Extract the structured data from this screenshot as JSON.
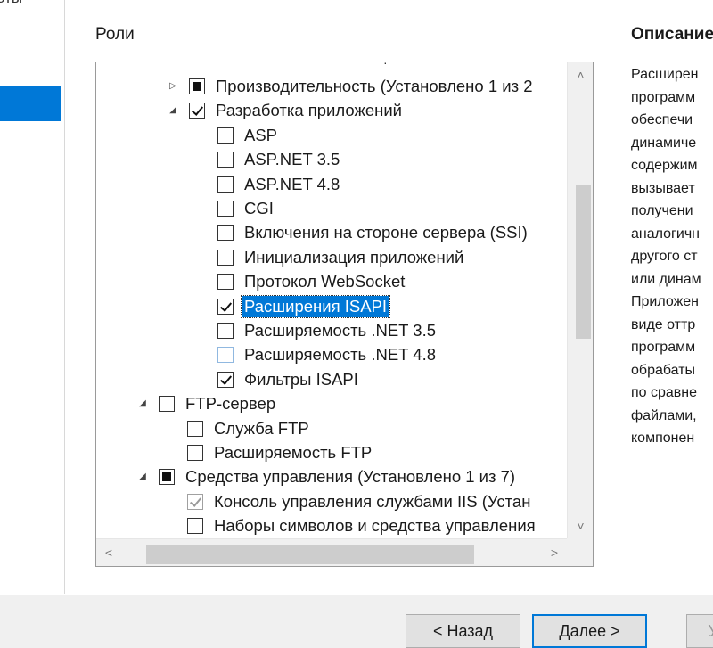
{
  "left_panel": {
    "cut_text": "оты"
  },
  "headings": {
    "roles": "Роли",
    "description": "Описание"
  },
  "tree": {
    "cut_top_text": "·",
    "rows": [
      {
        "label": "Производительность (Установлено 1 из 2",
        "state": "partial",
        "expander": "collapsed"
      },
      {
        "label": "Разработка приложений",
        "state": "checked",
        "expander": "expanded"
      },
      {
        "label": "ASP",
        "state": "unchecked"
      },
      {
        "label": "ASP.NET 3.5",
        "state": "unchecked"
      },
      {
        "label": "ASP.NET 4.8",
        "state": "unchecked"
      },
      {
        "label": "CGI",
        "state": "unchecked"
      },
      {
        "label": "Включения на стороне сервера (SSI)",
        "state": "unchecked"
      },
      {
        "label": "Инициализация приложений",
        "state": "unchecked"
      },
      {
        "label": "Протокол WebSocket",
        "state": "unchecked"
      },
      {
        "label": "Расширения ISAPI",
        "state": "checked",
        "selected": true
      },
      {
        "label": "Расширяемость .NET 3.5",
        "state": "unchecked"
      },
      {
        "label": "Расширяемость .NET 4.8",
        "state": "unchecked",
        "hover": true
      },
      {
        "label": "Фильтры ISAPI",
        "state": "checked"
      },
      {
        "label": "FTP-сервер",
        "state": "unchecked",
        "expander": "expanded"
      },
      {
        "label": "Служба FTP",
        "state": "unchecked"
      },
      {
        "label": "Расширяемость FTP",
        "state": "unchecked"
      },
      {
        "label": "Средства управления (Установлено 1 из 7)",
        "state": "partial",
        "expander": "expanded"
      },
      {
        "label": "Консоль управления службами IIS (Устан",
        "state": "checked",
        "disabled": true
      },
      {
        "label": "Наборы символов и средства управления",
        "state": "unchecked"
      }
    ]
  },
  "scrollbars": {
    "vertical": {
      "up": "˄",
      "down": "˅",
      "thumb_start": 0.23,
      "thumb_size": 0.36
    },
    "horizontal": {
      "left": "˂",
      "right": "˃",
      "thumb_start": 0.06,
      "thumb_size": 0.78
    }
  },
  "description_lines": [
    "Расширен",
    "программ",
    "обеспечи",
    "динамиче",
    "содержим",
    "вызывает",
    "получени",
    "аналогичн",
    "другого ст",
    "или динам",
    "Приложен",
    "виде оттр",
    "программ",
    "обрабаты",
    "по сравне",
    "файлами,",
    "компонен"
  ],
  "buttons": {
    "back": "< Назад",
    "next": "Далее >",
    "install": "У"
  }
}
